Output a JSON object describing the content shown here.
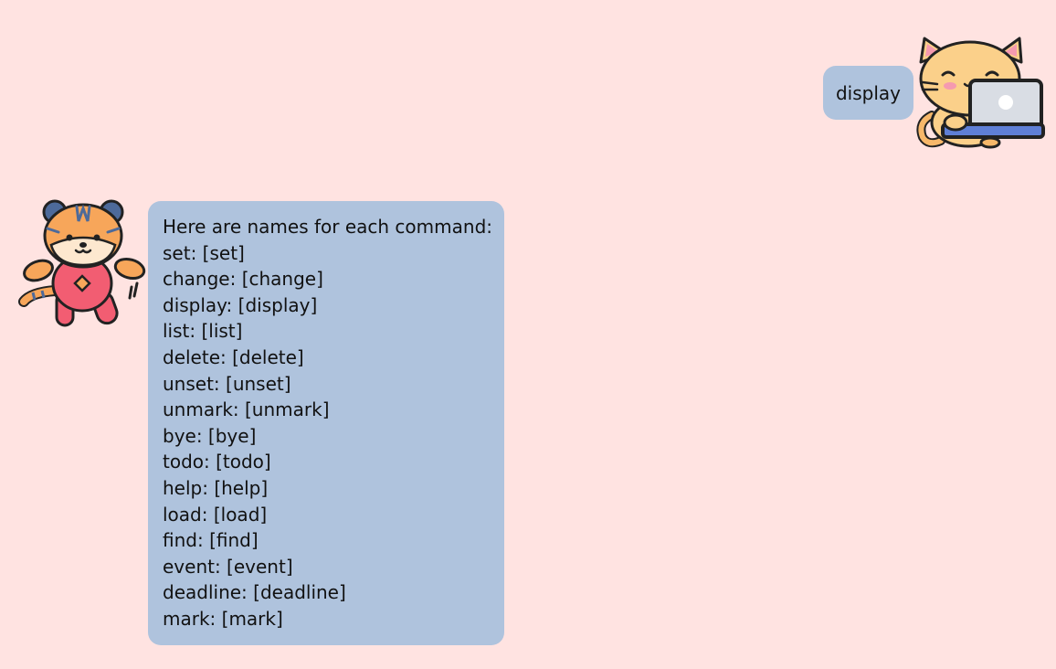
{
  "conversation": {
    "user_message": "display",
    "bot_message": {
      "heading": "Here are names for each command:",
      "lines": [
        "set: [set]",
        "change: [change]",
        "display: [display]",
        "list: [list]",
        "delete: [delete]",
        "unset: [unset]",
        "unmark: [unmark]",
        "bye: [bye]",
        "todo: [todo]",
        "help: [help]",
        "load: [load]",
        "find: [find]",
        "event: [event]",
        "deadline: [deadline]",
        "mark: [mark]"
      ]
    }
  },
  "avatars": {
    "user": "cat-with-laptop-icon",
    "bot": "tiger-icon"
  },
  "colors": {
    "background": "#ffe3e1",
    "bubble": "#afc3dd"
  }
}
